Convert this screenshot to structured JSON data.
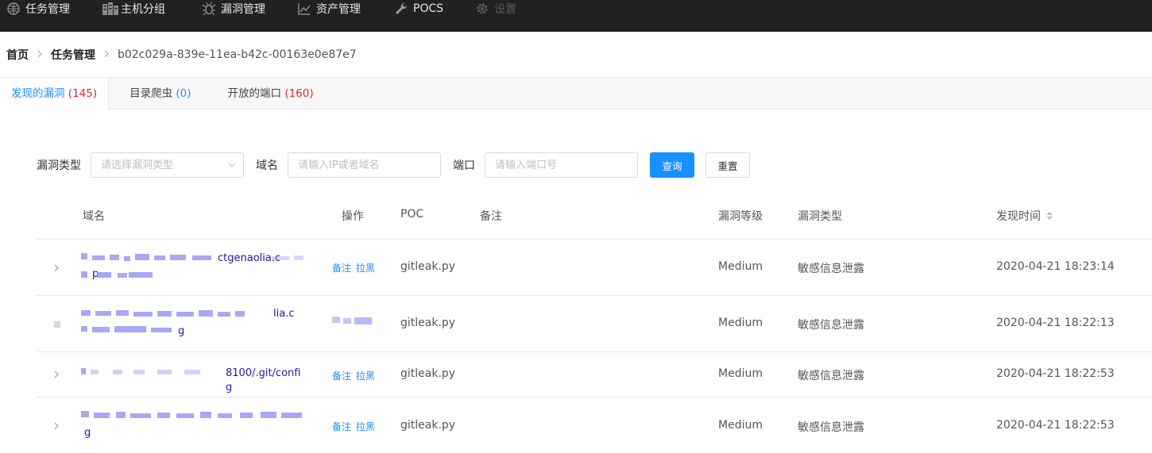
{
  "nav": {
    "items": [
      {
        "label": "任务管理",
        "icon": "globe-icon"
      },
      {
        "label": "主机分组",
        "icon": "server-icon"
      },
      {
        "label": "漏洞管理",
        "icon": "bug-icon"
      },
      {
        "label": "资产管理",
        "icon": "chart-icon"
      },
      {
        "label": "POCS",
        "icon": "wrench-icon"
      },
      {
        "label": "设置",
        "icon": "gear-icon",
        "disabled": true
      }
    ]
  },
  "breadcrumb": {
    "home": "首页",
    "section": "任务管理",
    "current": "b02c029a-839e-11ea-b42c-00163e0e87e7"
  },
  "tabs": [
    {
      "label": "发现的漏洞",
      "count": "(145)",
      "active": true
    },
    {
      "label": "目录爬虫",
      "count": "(0)"
    },
    {
      "label": "开放的端口",
      "count": "(160)"
    }
  ],
  "filters": {
    "vuln_type_label": "漏洞类型",
    "vuln_type_placeholder": "请选择漏洞类型",
    "domain_label": "域名",
    "domain_placeholder": "请输入IP或者域名",
    "port_label": "端口",
    "port_placeholder": "请输入端口号",
    "query_button": "查询",
    "reset_button": "重置"
  },
  "table": {
    "columns": {
      "domain": "域名",
      "action": "操作",
      "poc": "POC",
      "note": "备注",
      "level": "漏洞等级",
      "type": "漏洞类型",
      "time": "发现时间"
    },
    "rows": [
      {
        "domain_visible": "ctgenaolia.c",
        "domain_line2": "p",
        "actions": [
          "备注",
          "拉黑"
        ],
        "poc": "gitleak.py",
        "level": "Medium",
        "type": "敏感信息泄露",
        "time": "2020-04-21 18:23:14"
      },
      {
        "domain_visible": "lia.c",
        "domain_line2": "g",
        "actions": [],
        "poc": "gitleak.py",
        "level": "Medium",
        "type": "敏感信息泄露",
        "time": "2020-04-21 18:22:13"
      },
      {
        "domain_visible": "8100/.git/config",
        "domain_line2": "",
        "actions": [
          "备注",
          "拉黑"
        ],
        "poc": "gitleak.py",
        "level": "Medium",
        "type": "敏感信息泄露",
        "time": "2020-04-21 18:22:53"
      },
      {
        "domain_visible": "",
        "domain_line2": "g",
        "actions": [
          "备注",
          "拉黑"
        ],
        "poc": "gitleak.py",
        "level": "Medium",
        "type": "敏感信息泄露",
        "time": "2020-04-21 18:22:53"
      }
    ]
  },
  "colors": {
    "accent": "#1890ff",
    "danger": "#e8261a",
    "nav_bg": "#212121"
  }
}
